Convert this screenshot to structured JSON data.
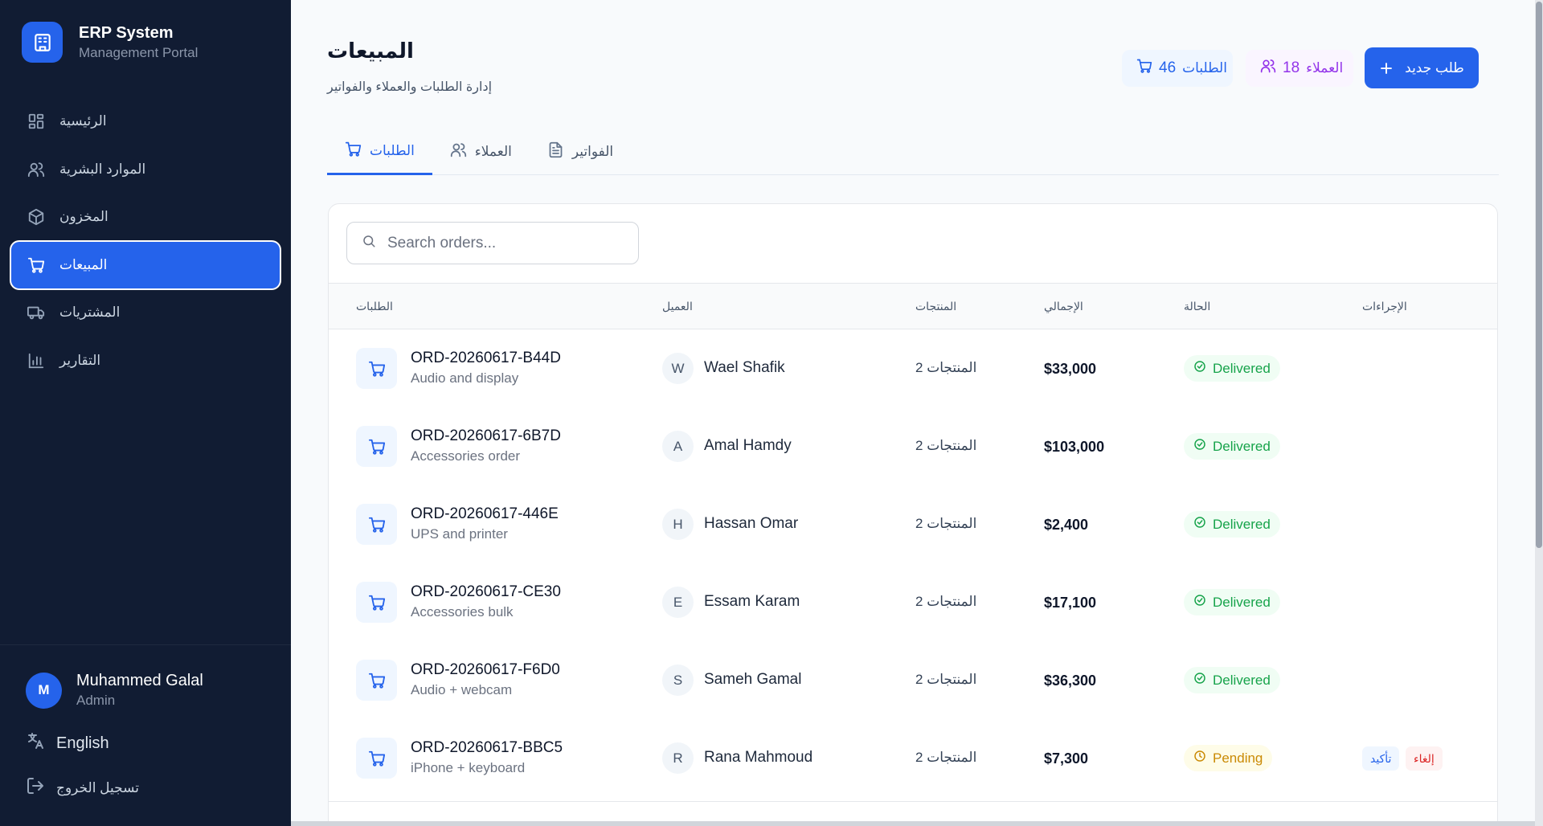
{
  "brand": {
    "title": "ERP System",
    "subtitle": "Management Portal"
  },
  "sidebar": {
    "items": [
      {
        "label": "الرئيسية",
        "icon": "dashboard-icon",
        "active": false
      },
      {
        "label": "الموارد البشرية",
        "icon": "users-icon",
        "active": false
      },
      {
        "label": "المخزون",
        "icon": "package-icon",
        "active": false
      },
      {
        "label": "المبيعات",
        "icon": "cart-icon",
        "active": true
      },
      {
        "label": "المشتريات",
        "icon": "truck-icon",
        "active": false
      },
      {
        "label": "التقارير",
        "icon": "bar-chart-icon",
        "active": false
      }
    ],
    "user": {
      "initial": "M",
      "name": "Muhammed Galal",
      "role": "Admin"
    },
    "language": "English",
    "logout": "تسجيل الخروج"
  },
  "header": {
    "title": "المبيعات",
    "subtitle": "إدارة الطلبات والعملاء والفواتير",
    "orders_count": "46",
    "orders_label": "الطلبات",
    "customers_count": "18",
    "customers_label": "العملاء",
    "new_order_label": "طلب جديد"
  },
  "tabs": [
    {
      "label": "الطلبات",
      "icon": "cart-icon",
      "active": true
    },
    {
      "label": "العملاء",
      "icon": "users-icon",
      "active": false
    },
    {
      "label": "الفواتير",
      "icon": "document-icon",
      "active": false
    }
  ],
  "search": {
    "placeholder": "Search orders...",
    "value": ""
  },
  "table": {
    "columns": [
      "الطلبات",
      "العميل",
      "المنتجات",
      "الإجمالي",
      "الحالة",
      "الإجراءات"
    ],
    "rows": [
      {
        "id": "ORD-20260617-B44D",
        "desc": "Audio and display",
        "initial": "W",
        "customer": "Wael Shafik",
        "items": "2 المنتجات",
        "total": "$33,000",
        "status": "Delivered"
      },
      {
        "id": "ORD-20260617-6B7D",
        "desc": "Accessories order",
        "initial": "A",
        "customer": "Amal Hamdy",
        "items": "2 المنتجات",
        "total": "$103,000",
        "status": "Delivered"
      },
      {
        "id": "ORD-20260617-446E",
        "desc": "UPS and printer",
        "initial": "H",
        "customer": "Hassan Omar",
        "items": "2 المنتجات",
        "total": "$2,400",
        "status": "Delivered"
      },
      {
        "id": "ORD-20260617-CE30",
        "desc": "Accessories bulk",
        "initial": "E",
        "customer": "Essam Karam",
        "items": "2 المنتجات",
        "total": "$17,100",
        "status": "Delivered"
      },
      {
        "id": "ORD-20260617-F6D0",
        "desc": "Audio + webcam",
        "initial": "S",
        "customer": "Sameh Gamal",
        "items": "2 المنتجات",
        "total": "$36,300",
        "status": "Delivered"
      },
      {
        "id": "ORD-20260617-BBC5",
        "desc": "iPhone + keyboard",
        "initial": "R",
        "customer": "Rana Mahmoud",
        "items": "2 المنتجات",
        "total": "$7,300",
        "status": "Pending",
        "actions": {
          "confirm": "تأكيد",
          "cancel": "إلغاء"
        }
      }
    ]
  },
  "colors": {
    "accent": "#2563eb",
    "sidebar_bg": "#111c33",
    "delivered": "#16a34a",
    "pending": "#ca8a04",
    "danger": "#dc2626"
  }
}
